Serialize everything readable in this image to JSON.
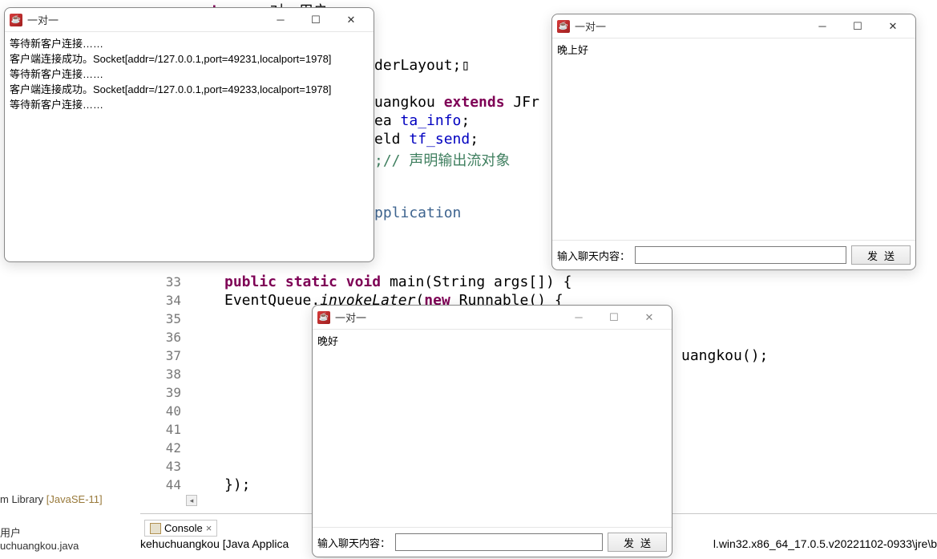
{
  "pkg": "package",
  "pkg_tail": " 一对一用户;",
  "code_border": "derLayout;",
  "code_ext_pre": "uangkou ",
  "code_ext_kw": "extends",
  "code_ext_post": " JFr",
  "code_ta": "ea ",
  "code_ta_field": "ta_info",
  "code_tf": "eld ",
  "code_tf_field": "tf_send",
  "code_cmt_pre": ";// ",
  "code_cmt": "声明输出流对象",
  "code_app": "pplication",
  "lines": {
    "l33": {
      "n": "33",
      "t": "public static void main(String args[]) {"
    },
    "l34": {
      "n": "34",
      "t": "    EventQueue.invokeLater(new Runnable() {"
    },
    "l35": {
      "n": "35"
    },
    "l36": {
      "n": "36"
    },
    "l37": {
      "n": "37",
      "t": "uangkou();"
    },
    "l38": {
      "n": "38"
    },
    "l39": {
      "n": "39"
    },
    "l40": {
      "n": "40"
    },
    "l41": {
      "n": "41"
    },
    "l42": {
      "n": "42"
    },
    "l43": {
      "n": "43"
    },
    "l44": {
      "n": "44",
      "t": "    });"
    }
  },
  "kw_public": "public",
  "kw_static": "static",
  "kw_void": "void",
  "kw_new": "new",
  "main_sig_mid": " main(String args[]) {",
  "eq_pre": "    EventQueue.",
  "eq_mthd": "invokeLater",
  "eq_mid": "(",
  "eq_run": " Runnable() {",
  "win1": {
    "title": "一对一",
    "lines": [
      "等待新客户连接……",
      "客户端连接成功。Socket[addr=/127.0.0.1,port=49231,localport=1978]",
      "等待新客户连接……",
      "客户端连接成功。Socket[addr=/127.0.0.1,port=49233,localport=1978]",
      "等待新客户连接……"
    ]
  },
  "win2": {
    "title": "一对一",
    "text": "晚上好",
    "label": "输入聊天内容：",
    "send": "发送"
  },
  "win3": {
    "title": "一对一",
    "text": "晚好",
    "label": "输入聊天内容：",
    "send": "发送"
  },
  "sidebar": {
    "lib_pre": "m Library ",
    "lib": "[JavaSE-11]",
    "user": "用户",
    "file": "uchuangkou.java"
  },
  "console": {
    "tab": "Console",
    "line_pre": "kehuchuangkou [Java Applica",
    "status": "l.win32.x86_64_17.0.5.v20221102-0933\\jre\\b"
  }
}
